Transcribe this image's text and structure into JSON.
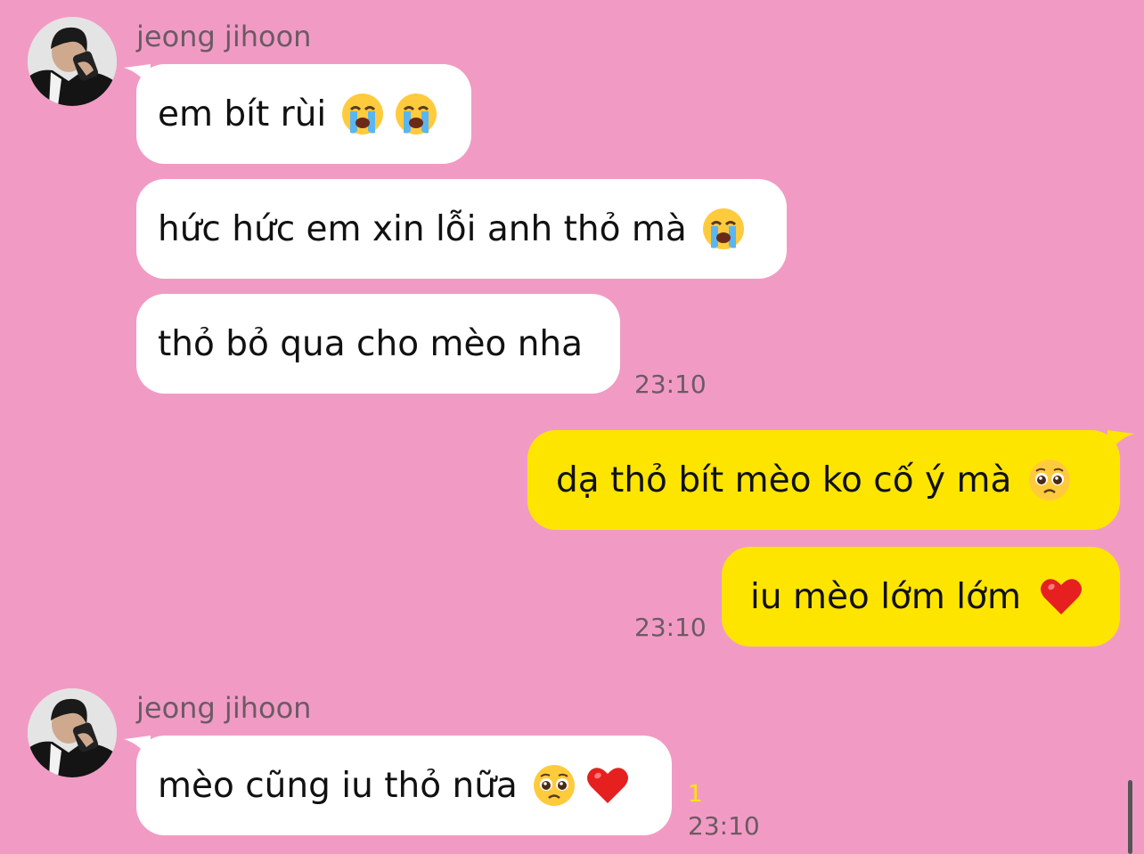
{
  "chat": {
    "groups": [
      {
        "sender": "jeong jihoon",
        "messages": [
          {
            "text": "em bít rùi",
            "emojis": [
              "loudly-crying-face",
              "loudly-crying-face"
            ]
          },
          {
            "text": "hức hức em xin lỗi anh thỏ mà",
            "emojis": [
              "loudly-crying-face"
            ]
          },
          {
            "text": "thỏ bỏ qua cho mèo nha",
            "emojis": []
          }
        ],
        "time": "23:10"
      },
      {
        "sender": "me",
        "messages": [
          {
            "text": "dạ thỏ bít mèo ko cố ý mà",
            "emojis": [
              "pleading-face"
            ]
          },
          {
            "text": "iu mèo lớm lớm",
            "emojis": [
              "red-heart"
            ]
          }
        ],
        "time": "23:10"
      },
      {
        "sender": "jeong jihoon",
        "messages": [
          {
            "text": "mèo cũng iu thỏ nữa",
            "emojis": [
              "pleading-face",
              "red-heart"
            ]
          }
        ],
        "unread_count": "1",
        "time": "23:10"
      }
    ]
  },
  "colors": {
    "background": "#f19bc4",
    "incoming_bubble": "#ffffff",
    "outgoing_bubble": "#fee500",
    "unread": "#fee500",
    "meta_text": "#6b5a64"
  }
}
